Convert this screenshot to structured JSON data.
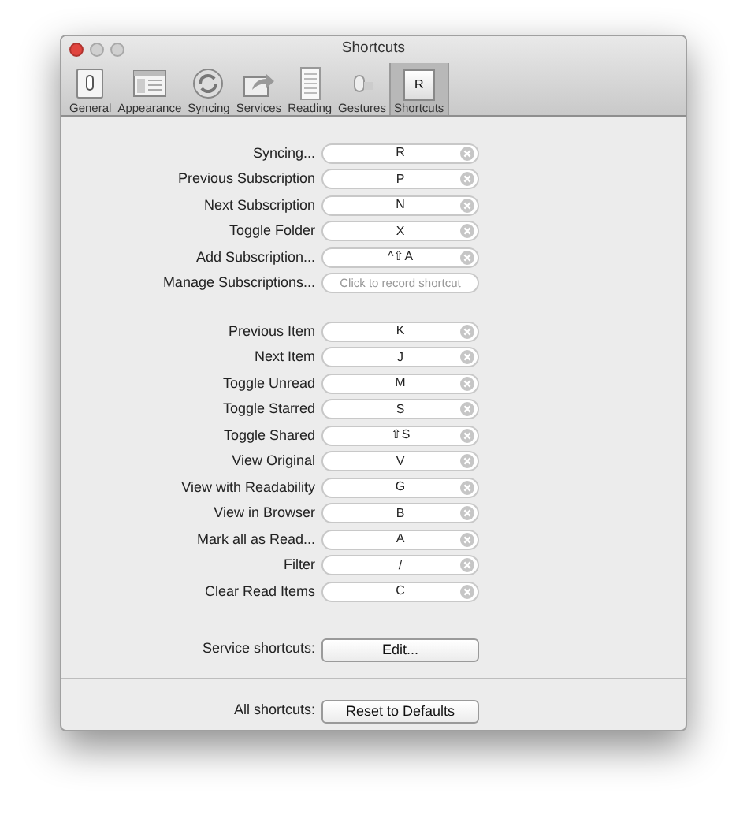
{
  "window": {
    "title": "Shortcuts"
  },
  "toolbar": [
    {
      "label": "General",
      "kind": "general",
      "selected": false
    },
    {
      "label": "Appearance",
      "kind": "appearance",
      "selected": false
    },
    {
      "label": "Syncing",
      "kind": "syncing",
      "selected": false
    },
    {
      "label": "Services",
      "kind": "services",
      "selected": false
    },
    {
      "label": "Reading",
      "kind": "reading",
      "selected": false
    },
    {
      "label": "Gestures",
      "kind": "gestures",
      "selected": false
    },
    {
      "label": "Shortcuts",
      "kind": "keycap",
      "keycap": "R",
      "selected": true
    }
  ],
  "groups": [
    [
      {
        "label": "Syncing...",
        "value": "R"
      },
      {
        "label": "Previous Subscription",
        "value": "P"
      },
      {
        "label": "Next Subscription",
        "value": "N"
      },
      {
        "label": "Toggle Folder",
        "value": "X"
      },
      {
        "label": "Add Subscription...",
        "value": "^⇧A"
      },
      {
        "label": "Manage Subscriptions...",
        "placeholder": "Click to record shortcut"
      }
    ],
    [
      {
        "label": "Previous Item",
        "value": "K"
      },
      {
        "label": "Next Item",
        "value": "J"
      },
      {
        "label": "Toggle Unread",
        "value": "M"
      },
      {
        "label": "Toggle Starred",
        "value": "S"
      },
      {
        "label": "Toggle Shared",
        "value": "⇧S"
      },
      {
        "label": "View Original",
        "value": "V"
      },
      {
        "label": "View with Readability",
        "value": "G"
      },
      {
        "label": "View in Browser",
        "value": "B"
      },
      {
        "label": "Mark all as Read...",
        "value": "A"
      },
      {
        "label": "Filter",
        "value": "/"
      },
      {
        "label": "Clear Read Items",
        "value": "C"
      }
    ]
  ],
  "service_shortcuts": {
    "label": "Service shortcuts:",
    "button": "Edit..."
  },
  "all_shortcuts": {
    "label": "All shortcuts:",
    "button": "Reset to Defaults"
  }
}
